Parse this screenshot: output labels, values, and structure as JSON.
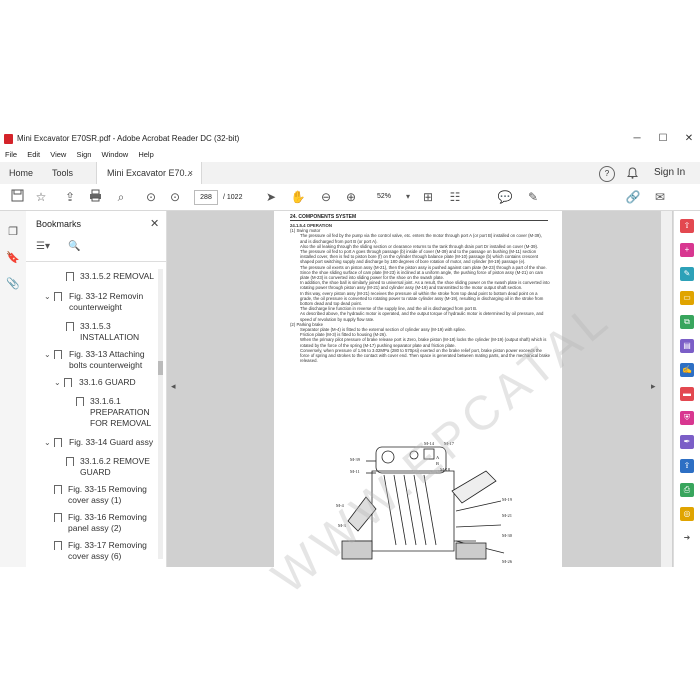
{
  "window": {
    "title": "Mini Excavator E70SR.pdf - Adobe Acrobat Reader DC (32-bit)",
    "controls": {
      "minimize": "─",
      "maximize": "☐",
      "close": "✕"
    }
  },
  "menu": [
    "File",
    "Edit",
    "View",
    "Sign",
    "Window",
    "Help"
  ],
  "tabs": {
    "home": "Home",
    "tools": "Tools",
    "document": "Mini Excavator E70...",
    "close": "×"
  },
  "header_right": {
    "help": "?",
    "bell": "🔔",
    "sign_in": "Sign In"
  },
  "toolbar": {
    "page_current": "288",
    "page_total": "/ 1022",
    "zoom": "52%"
  },
  "bookmarks": {
    "title": "Bookmarks",
    "close": "✕",
    "items": [
      {
        "label1": "33.1.5.2 REMOVAL",
        "label2": ""
      },
      {
        "label1": "Fig. 33-12 Removin",
        "label2": "counterweight"
      },
      {
        "label1": "33.1.5.3",
        "label2": "INSTALLATION"
      },
      {
        "label1": "Fig. 33-13 Attaching",
        "label2": "bolts counterweight"
      },
      {
        "label1": "33.1.6 GUARD",
        "label2": ""
      },
      {
        "label1": "33.1.6.1",
        "label2": "PREPARATION",
        "label3": "FOR REMOVAL"
      },
      {
        "label1": "Fig. 33-14 Guard assy",
        "label2": ""
      },
      {
        "label1": "33.1.6.2 REMOVE",
        "label2": "GUARD"
      },
      {
        "label1": "Fig. 33-15 Removing",
        "label2": "cover assy (1)"
      },
      {
        "label1": "Fig. 33-16 Removing",
        "label2": "panel assy (2)"
      },
      {
        "label1": "Fig. 33-17 Removing",
        "label2": "cover assy (6)"
      }
    ]
  },
  "page": {
    "header": "24. COMPONENTS SYSTEM",
    "section": "24.1.5.4      OPERATION",
    "paragraphs": [
      "(1)  Swing motor",
      "The pressure oil fed by the pump via the control valve, etc. enters the motor through port A (or port B) installed on cover (M-39), and is discharged from port B (or port A).",
      "Also the oil leaking through the sliding section or clearance returns to the tank through drain port Dr installed on cover (M-39).",
      "The pressure oil fed to port A goes through passage (b) inside of cover (M-39) and to the passage on bushing (M-11) section installed cover, then is fed to piston bore (f) on the cylinder through balance plate (M-10) passage (b) which contains crescent shaped port switching supply and discharge by 180 degrees of bore rotation of motor, and cylinder (M-19) passage (e).",
      "The pressure oil exerts on piston assy (M-21), then the piston assy is pushed against cam plate (M-23) through a part of the shoe. Since the shoe sliding surface of cam plate (M-23) is inclined at a uniform angle, the pushing force of piston assy (M-21) on cam plate (M-23) is converted into sliding power for the shoe on the swash plate.",
      "In addition, the shoe ball is similarly joined to universal joint. As a result, the shoe sliding power on the swash plate is converted into rotating power through piston assy (M-21) and cylinder assy (M-19) and transmitted to the motor output shaft section.",
      "In this way, every piston assy (M-21) receives the pressure oil within the stroke from top dead point to bottom dead point on a grade, the oil pressure is converted to rotating power to rotate cylinder assy (M-19), resulting in discharging oil in the stroke from bottom dead and top dead point.",
      "The discharge line function in reverse of the supply line, and the oil is discharged from port B.",
      "As described above, the hydraulic motor is operated, and the output torque of hydraulic motor is determined by oil pressure, and speed of revolution by supply flow rate.",
      "(2)  Parking brake",
      "Separator plate (M-4) is fitted to the external section of cylinder assy (M-19) with spline.",
      "Friction plate (M-3) is fitted to housing (M-26).",
      "When the primary pilot pressure of brake release port is Zero, brake piston (M-18) locks the cylinder (M-19) (output shaft) which is rotated by the force of the spring (M-17) pushing separator plate and friction plate.",
      "Conversely, when pressure of 1.96 to 3.02MPa (280 to 570psi) exerted on the brake relief port, brake piston power exceeds the force of spring and strokes to the contact with cover end. Then space is generated between mating parts, and the mechanical brake released."
    ],
    "diagram_labels": [
      "M-39",
      "M-14",
      "M-17",
      "A",
      "B",
      "M-18",
      "M-19",
      "M-21",
      "M-4",
      "M-3",
      "M-26",
      "M-30",
      "M-11"
    ]
  },
  "watermark": "WWW.EPCATAL",
  "colors": {
    "acrobat_red": "#d4232a",
    "tab_bg": "#f2f2f2",
    "doc_bg": "#d0d0d0"
  }
}
